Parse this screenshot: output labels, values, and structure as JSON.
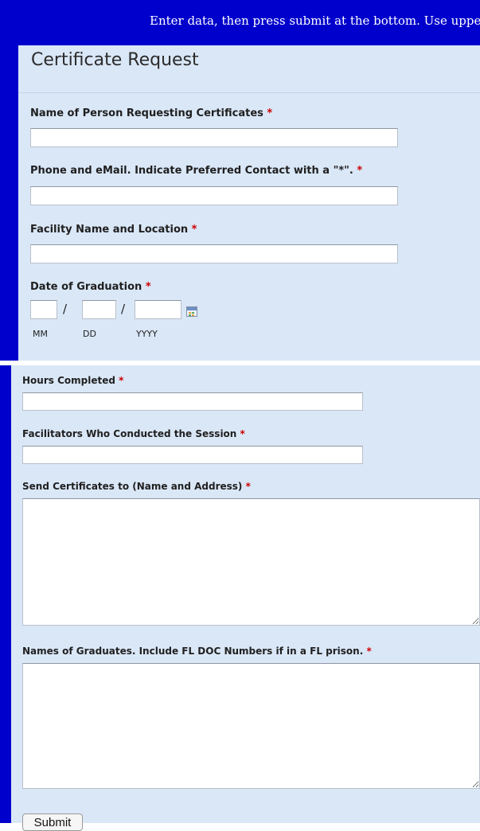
{
  "banner": {
    "text": "Enter data, then press submit at the bottom. Use upper"
  },
  "form": {
    "title": "Certificate Request",
    "required_marker": "*",
    "fields": {
      "requester_name": {
        "label": "Name of Person Requesting Certificates",
        "value": ""
      },
      "phone_email": {
        "label": "Phone and eMail. Indicate Preferred Contact with a \"*\".",
        "value": ""
      },
      "facility": {
        "label": "Facility Name and Location",
        "value": ""
      },
      "graduation_date": {
        "label": "Date of Graduation",
        "mm_label": "MM",
        "dd_label": "DD",
        "yyyy_label": "YYYY",
        "separator": "/",
        "icon": "calendar-icon"
      },
      "hours": {
        "label": "Hours Completed",
        "value": ""
      },
      "facilitators": {
        "label": "Facilitators Who Conducted the Session",
        "value": ""
      },
      "send_to": {
        "label": "Send Certificates to (Name and Address)",
        "value": ""
      },
      "graduates": {
        "label": "Names of Graduates. Include FL DOC Numbers if in a FL prison.",
        "value": ""
      }
    },
    "submit_label": "Submit"
  },
  "colors": {
    "frame_blue": "#0000cc",
    "panel_bg": "#dae7f7",
    "required_red": "#cc0000"
  }
}
